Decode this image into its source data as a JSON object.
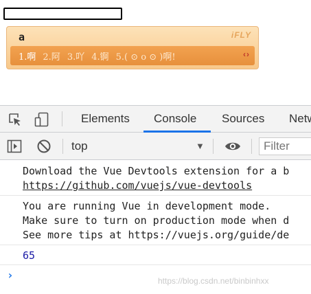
{
  "page": {
    "input_value": ""
  },
  "ime": {
    "composition": "a",
    "logo": "iFLY",
    "candidates": [
      "1.啊",
      "2.阿",
      "3.吖",
      "4.锕",
      "5.( ⊙ o ⊙ )啊!"
    ],
    "page_arrows": "‹›"
  },
  "devtools": {
    "tabs": [
      "Elements",
      "Console",
      "Sources",
      "Netw"
    ],
    "active_tab": "Console",
    "context": "top",
    "filter_placeholder": "Filter",
    "icons": [
      "inspect-element-icon",
      "device-toolbar-icon",
      "show-sidebar-icon",
      "clear-console-icon",
      "eye-icon"
    ],
    "accent_color": "#1a73e8"
  },
  "console": {
    "messages": [
      {
        "lines": [
          "Download the Vue Devtools extension for a b",
          "https://github.com/vuejs/vue-devtools"
        ]
      },
      {
        "lines": [
          "You are running Vue in development mode.",
          "Make sure to turn on production mode when d",
          "See more tips at https://vuejs.org/guide/de"
        ]
      },
      {
        "lines": [
          "65"
        ]
      }
    ],
    "prompt": "›"
  },
  "watermark": "https://blog.csdn.net/binbinhxx"
}
